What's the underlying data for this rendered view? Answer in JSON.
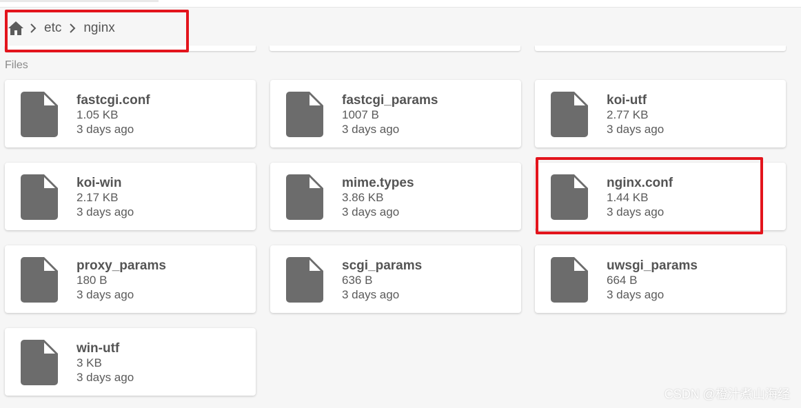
{
  "breadcrumb": {
    "home_icon": "home-icon",
    "separator_icon": "chevron-right-icon",
    "items": [
      "etc",
      "nginx"
    ]
  },
  "section": {
    "files_label": "Files"
  },
  "file_icon": "file-icon",
  "files": [
    {
      "name": "fastcgi.conf",
      "size": "1.05 KB",
      "modified": "3 days ago"
    },
    {
      "name": "fastcgi_params",
      "size": "1007 B",
      "modified": "3 days ago"
    },
    {
      "name": "koi-utf",
      "size": "2.77 KB",
      "modified": "3 days ago"
    },
    {
      "name": "koi-win",
      "size": "2.17 KB",
      "modified": "3 days ago"
    },
    {
      "name": "mime.types",
      "size": "3.86 KB",
      "modified": "3 days ago"
    },
    {
      "name": "nginx.conf",
      "size": "1.44 KB",
      "modified": "3 days ago"
    },
    {
      "name": "proxy_params",
      "size": "180 B",
      "modified": "3 days ago"
    },
    {
      "name": "scgi_params",
      "size": "636 B",
      "modified": "3 days ago"
    },
    {
      "name": "uwsgi_params",
      "size": "664 B",
      "modified": "3 days ago"
    },
    {
      "name": "win-utf",
      "size": "3 KB",
      "modified": "3 days ago"
    }
  ],
  "annotations": {
    "highlight_color": "#e3141c"
  },
  "watermark": "CSDN @橙汁煮山海经"
}
